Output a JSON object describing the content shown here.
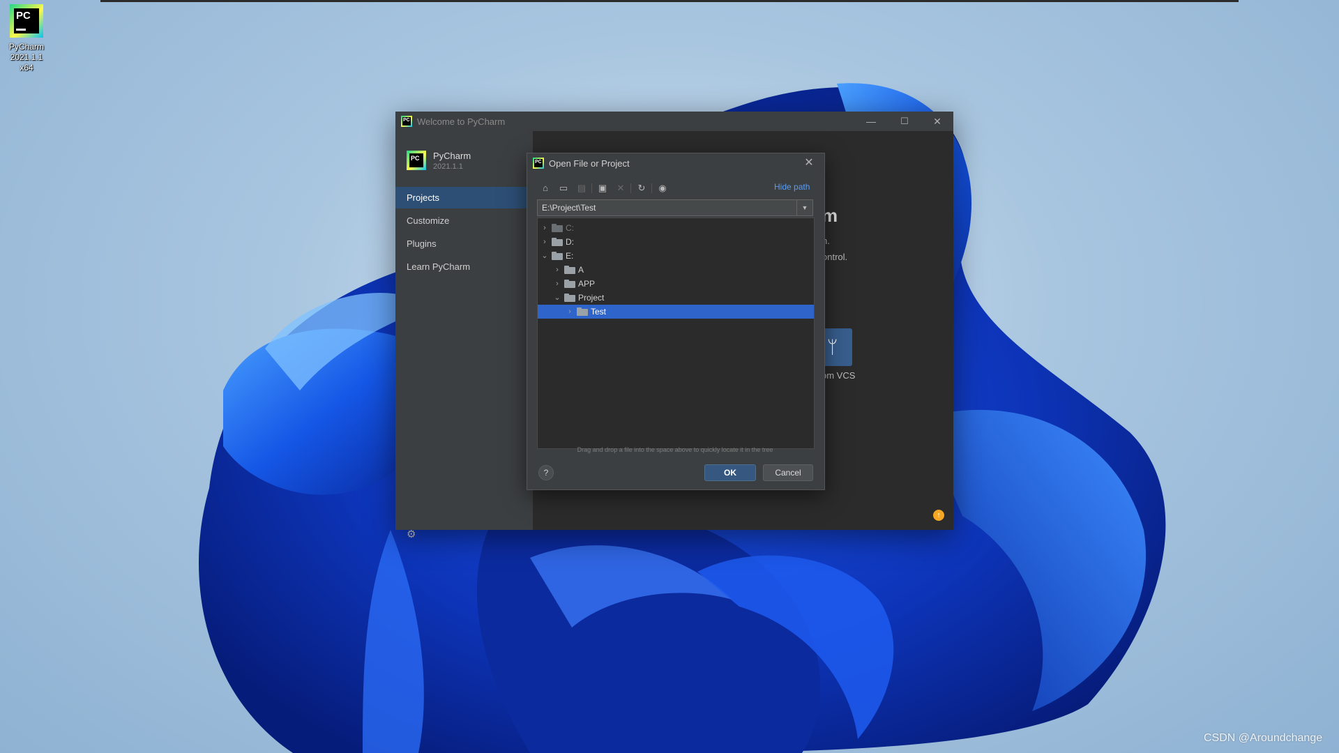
{
  "desktop": {
    "icon_label_line1": "PyCharm",
    "icon_label_line2": "2021.1.1 x64",
    "logo_text": "PC",
    "watermark": "CSDN @Aroundchange"
  },
  "welcome_window": {
    "title": "Welcome to PyCharm",
    "controls": {
      "minimize": "—",
      "maximize": "☐",
      "close": "✕"
    },
    "brand": {
      "name": "PyCharm",
      "version": "2021.1.1"
    },
    "nav": [
      {
        "label": "Projects",
        "active": true
      },
      {
        "label": "Customize",
        "active": false
      },
      {
        "label": "Plugins",
        "active": false
      },
      {
        "label": "Learn PyCharm",
        "active": false
      }
    ],
    "background_fragments": {
      "title_tail": "m",
      "line1_tail": "h.",
      "line2_tail": "ontrol.",
      "vcs_label_tail": "om VCS",
      "vcs_glyph": "ᛘ"
    },
    "update_badge": "↑"
  },
  "dialog": {
    "title": "Open File or Project",
    "close": "✕",
    "hide_path_label": "Hide path",
    "path_value": "E:\\Project\\Test",
    "tree": [
      {
        "label": "C:",
        "expanded": false,
        "depth": 0,
        "dim": true,
        "selected": false
      },
      {
        "label": "D:",
        "expanded": false,
        "depth": 0,
        "dim": false,
        "selected": false
      },
      {
        "label": "E:",
        "expanded": true,
        "depth": 0,
        "dim": false,
        "selected": false
      },
      {
        "label": "A",
        "expanded": false,
        "depth": 1,
        "dim": false,
        "selected": false
      },
      {
        "label": "APP",
        "expanded": false,
        "depth": 1,
        "dim": false,
        "selected": false
      },
      {
        "label": "Project",
        "expanded": true,
        "depth": 1,
        "dim": false,
        "selected": false
      },
      {
        "label": "Test",
        "expanded": false,
        "depth": 2,
        "dim": false,
        "selected": true
      }
    ],
    "hint": "Drag and drop a file into the space above to quickly locate it in the tree",
    "help_label": "?",
    "ok_label": "OK",
    "cancel_label": "Cancel",
    "toolbar_icons": [
      "home-icon",
      "desktop-icon",
      "project-folder-icon",
      "new-folder-icon",
      "delete-icon",
      "refresh-icon",
      "show-hidden-icon"
    ]
  },
  "colors": {
    "accent_blue": "#589df6",
    "selection": "#2f65ca",
    "nav_active": "#2d4f75",
    "ok_button": "#365880"
  }
}
